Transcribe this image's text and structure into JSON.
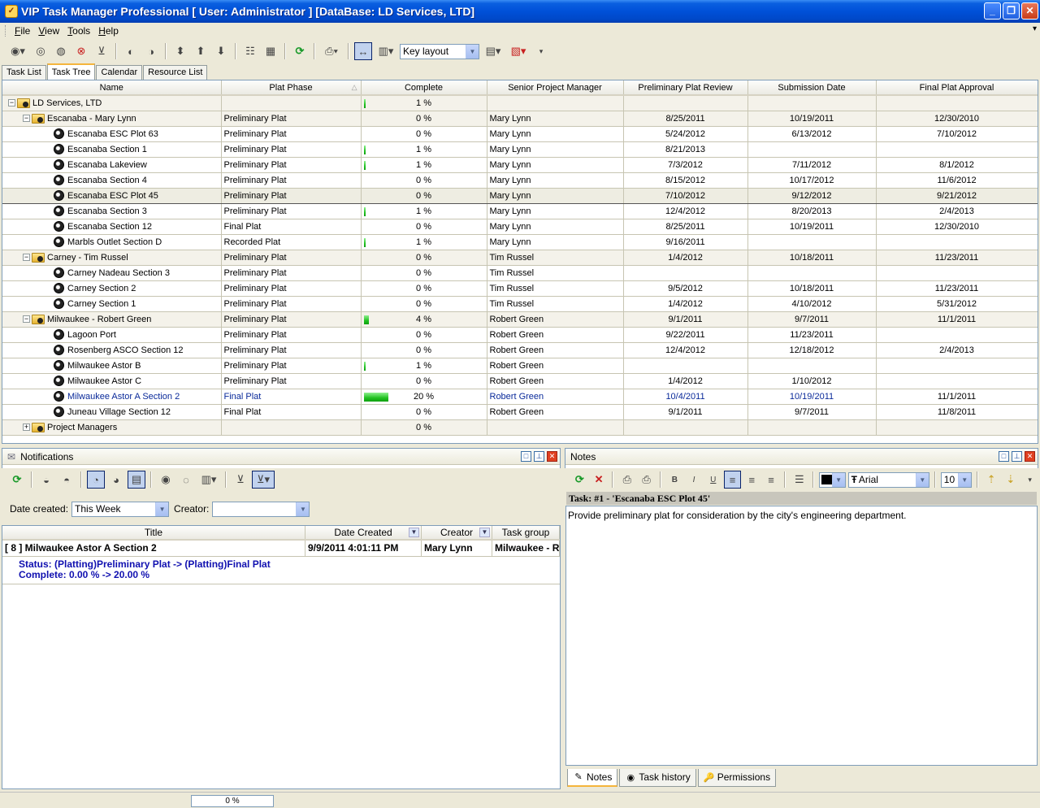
{
  "window": {
    "title": "VIP Task Manager Professional [ User: Administrator ] [DataBase: LD Services, LTD]"
  },
  "menu": [
    "File",
    "View",
    "Tools",
    "Help"
  ],
  "toolbar": {
    "layout_combo": "Key layout"
  },
  "tabs": [
    "Task List",
    "Task Tree",
    "Calendar",
    "Resource List"
  ],
  "active_tab": "Task Tree",
  "grid": {
    "columns": [
      "Name",
      "Plat Phase",
      "Complete",
      "Senior Project Manager",
      "Preliminary Plat Review",
      "Submission Date",
      "Final Plat Approval"
    ],
    "rows": [
      {
        "level": 0,
        "type": "group",
        "expand": "-",
        "name": "LD Services, LTD",
        "phase": "",
        "complete": "1 %",
        "pct": 1,
        "spm": "",
        "ppr": "",
        "sub": "",
        "fpa": ""
      },
      {
        "level": 1,
        "type": "group",
        "expand": "-",
        "name": "Escanaba - Mary Lynn",
        "phase": "Preliminary Plat",
        "complete": "0 %",
        "pct": 0,
        "spm": "Mary Lynn",
        "ppr": "8/25/2011",
        "sub": "10/19/2011",
        "fpa": "12/30/2010"
      },
      {
        "level": 2,
        "type": "task",
        "name": "Escanaba ESC Plot 63",
        "phase": "Preliminary Plat",
        "complete": "0 %",
        "pct": 0,
        "spm": "Mary Lynn",
        "ppr": "5/24/2012",
        "sub": "6/13/2012",
        "fpa": "7/10/2012"
      },
      {
        "level": 2,
        "type": "task",
        "name": "Escanaba Section 1",
        "phase": "Preliminary Plat",
        "complete": "1 %",
        "pct": 1,
        "spm": "Mary Lynn",
        "ppr": "8/21/2013",
        "sub": "",
        "fpa": ""
      },
      {
        "level": 2,
        "type": "task",
        "name": "Escanaba Lakeview",
        "phase": "Preliminary Plat",
        "complete": "1 %",
        "pct": 1,
        "spm": "Mary Lynn",
        "ppr": "7/3/2012",
        "sub": "7/11/2012",
        "fpa": "8/1/2012"
      },
      {
        "level": 2,
        "type": "task",
        "name": "Escanaba Section 4",
        "phase": "Preliminary Plat",
        "complete": "0 %",
        "pct": 0,
        "spm": "Mary Lynn",
        "ppr": "8/15/2012",
        "sub": "10/17/2012",
        "fpa": "11/6/2012"
      },
      {
        "level": 2,
        "type": "task",
        "selected": true,
        "name": "Escanaba ESC Plot 45",
        "phase": "Preliminary Plat",
        "complete": "0 %",
        "pct": 0,
        "spm": "Mary Lynn",
        "ppr": "7/10/2012",
        "sub": "9/12/2012",
        "fpa": "9/21/2012"
      },
      {
        "level": 2,
        "type": "task",
        "name": "Escanaba Section 3",
        "phase": "Preliminary Plat",
        "complete": "1 %",
        "pct": 1,
        "spm": "Mary Lynn",
        "ppr": "12/4/2012",
        "sub": "8/20/2013",
        "fpa": "2/4/2013"
      },
      {
        "level": 2,
        "type": "task",
        "name": "Escanaba Section 12",
        "phase": "Final Plat",
        "complete": "0 %",
        "pct": 0,
        "spm": "Mary Lynn",
        "ppr": "8/25/2011",
        "sub": "10/19/2011",
        "fpa": "12/30/2010"
      },
      {
        "level": 2,
        "type": "task",
        "name": "Marbls Outlet Section D",
        "phase": "Recorded Plat",
        "complete": "1 %",
        "pct": 1,
        "spm": "Mary Lynn",
        "ppr": "9/16/2011",
        "sub": "",
        "fpa": ""
      },
      {
        "level": 1,
        "type": "group",
        "expand": "-",
        "name": "Carney - Tim Russel",
        "phase": "Preliminary Plat",
        "complete": "0 %",
        "pct": 0,
        "spm": "Tim Russel",
        "ppr": "1/4/2012",
        "sub": "10/18/2011",
        "fpa": "11/23/2011"
      },
      {
        "level": 2,
        "type": "task",
        "name": "Carney Nadeau Section 3",
        "phase": "Preliminary Plat",
        "complete": "0 %",
        "pct": 0,
        "spm": "Tim Russel",
        "ppr": "",
        "sub": "",
        "fpa": ""
      },
      {
        "level": 2,
        "type": "task",
        "name": "Carney Section 2",
        "phase": "Preliminary Plat",
        "complete": "0 %",
        "pct": 0,
        "spm": "Tim Russel",
        "ppr": "9/5/2012",
        "sub": "10/18/2011",
        "fpa": "11/23/2011"
      },
      {
        "level": 2,
        "type": "task",
        "name": "Carney Section 1",
        "phase": "Preliminary Plat",
        "complete": "0 %",
        "pct": 0,
        "spm": "Tim Russel",
        "ppr": "1/4/2012",
        "sub": "4/10/2012",
        "fpa": "5/31/2012"
      },
      {
        "level": 1,
        "type": "group",
        "expand": "-",
        "name": "Milwaukee - Robert Green",
        "phase": "Preliminary Plat",
        "complete": "4 %",
        "pct": 4,
        "spm": "Robert Green",
        "ppr": "9/1/2011",
        "sub": "9/7/2011",
        "fpa": "11/1/2011"
      },
      {
        "level": 2,
        "type": "task",
        "name": "Lagoon Port",
        "phase": "Preliminary Plat",
        "complete": "0 %",
        "pct": 0,
        "spm": "Robert Green",
        "ppr": "9/22/2011",
        "sub": "11/23/2011",
        "fpa": ""
      },
      {
        "level": 2,
        "type": "task",
        "name": "Rosenberg ASCO Section 12",
        "phase": "Preliminary Plat",
        "complete": "0 %",
        "pct": 0,
        "spm": "Robert Green",
        "ppr": "12/4/2012",
        "sub": "12/18/2012",
        "fpa": "2/4/2013"
      },
      {
        "level": 2,
        "type": "task",
        "name": "Milwaukee Astor B",
        "phase": "Preliminary Plat",
        "complete": "1 %",
        "pct": 1,
        "spm": "Robert Green",
        "ppr": "",
        "sub": "",
        "fpa": ""
      },
      {
        "level": 2,
        "type": "task",
        "name": "Milwaukee Astor C",
        "phase": "Preliminary Plat",
        "complete": "0 %",
        "pct": 0,
        "spm": "Robert Green",
        "ppr": "1/4/2012",
        "sub": "1/10/2012",
        "fpa": ""
      },
      {
        "level": 2,
        "type": "task",
        "highlight": true,
        "name": "Milwaukee  Astor A Section 2",
        "phase": "Final Plat",
        "complete": "20 %",
        "pct": 20,
        "spm": "Robert Green",
        "ppr": "10/4/2011",
        "sub": "10/19/2011",
        "fpa": "11/1/2011"
      },
      {
        "level": 2,
        "type": "task",
        "name": "Juneau Village Section 12",
        "phase": "Final Plat",
        "complete": "0 %",
        "pct": 0,
        "spm": "Robert Green",
        "ppr": "9/1/2011",
        "sub": "9/7/2011",
        "fpa": "11/8/2011"
      },
      {
        "level": 1,
        "type": "group",
        "expand": "+",
        "name": "Project Managers",
        "phase": "",
        "complete": "0 %",
        "pct": 0,
        "spm": "",
        "ppr": "",
        "sub": "",
        "fpa": ""
      }
    ]
  },
  "notifications": {
    "title": "Notifications",
    "date_created_label": "Date created:",
    "date_created_value": "This Week",
    "creator_label": "Creator:",
    "creator_value": "",
    "columns": [
      "Title",
      "Date Created",
      "Creator",
      "Task group"
    ],
    "item": {
      "title": "[ 8 ] Milwaukee  Astor A Section 2",
      "date": "9/9/2011 4:01:11 PM",
      "creator": "Mary Lynn",
      "group": "Milwaukee - R",
      "status_line": "Status: (Platting)Preliminary Plat -> (Platting)Final Plat",
      "complete_line": "Complete: 0.00 % -> 20.00 %"
    }
  },
  "notes": {
    "title": "Notes",
    "color": "#000000",
    "font": "Arial",
    "size": "10",
    "heading": "Task: #1 - 'Escanaba ESC Plot 45'",
    "body": "Provide preliminary plat for consideration by the city's engineering department.",
    "tabs": [
      "Notes",
      "Task history",
      "Permissions"
    ]
  },
  "status": {
    "progress": "0 %"
  }
}
